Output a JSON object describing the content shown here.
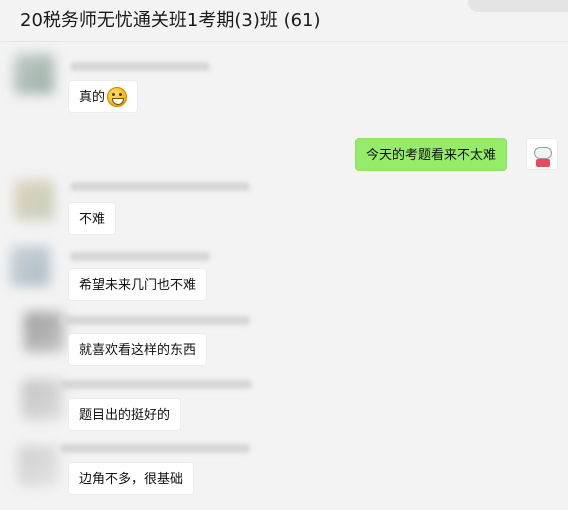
{
  "header": {
    "title": "20税务师无忧通关班1考期(3)班 (61)"
  },
  "messages": [
    {
      "text": "真的",
      "emoji": "grinning-face-emoji",
      "side": "left"
    },
    {
      "text": "今天的考题看来不太难",
      "side": "right"
    },
    {
      "text": "不难",
      "side": "left"
    },
    {
      "text": "希望未来几门也不难",
      "side": "left"
    },
    {
      "text": "就喜欢看这样的东西",
      "side": "left"
    },
    {
      "text": "题目出的挺好的",
      "side": "left"
    },
    {
      "text": "边角不多，很基础",
      "side": "left"
    }
  ],
  "colors": {
    "background": "#f3f3f3",
    "my_bubble": "#95ec69",
    "other_bubble": "#ffffff"
  }
}
